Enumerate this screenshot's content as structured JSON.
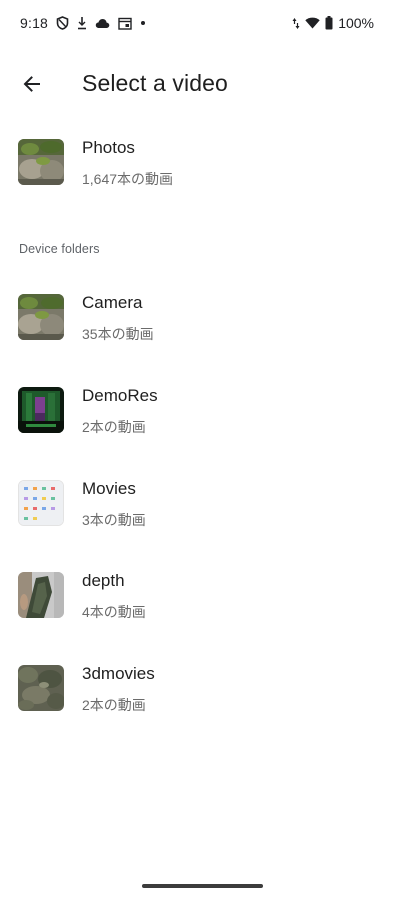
{
  "status_bar": {
    "time": "9:18",
    "battery": "100%",
    "left_icons": [
      "shield-icon",
      "download-icon",
      "cloud-icon",
      "calendar-icon",
      "dot-icon"
    ],
    "right_icons": [
      "data-arrows-icon",
      "wifi-icon",
      "battery-icon"
    ]
  },
  "app_bar": {
    "title": "Select a video",
    "back_icon": "arrow-back-icon"
  },
  "main_album": {
    "name": "Photos",
    "count": "1,647本の動画"
  },
  "section": {
    "title": "Device folders"
  },
  "folders": [
    {
      "name": "Camera",
      "count": "35本の動画"
    },
    {
      "name": "DemoRes",
      "count": "2本の動画"
    },
    {
      "name": "Movies",
      "count": "3本の動画"
    },
    {
      "name": "depth",
      "count": "4本の動画"
    },
    {
      "name": "3dmovies",
      "count": "2本の動画"
    }
  ],
  "colors": {
    "background": "#ffffff",
    "text_primary": "#1f1f1f",
    "text_secondary": "#6b6b6b"
  }
}
